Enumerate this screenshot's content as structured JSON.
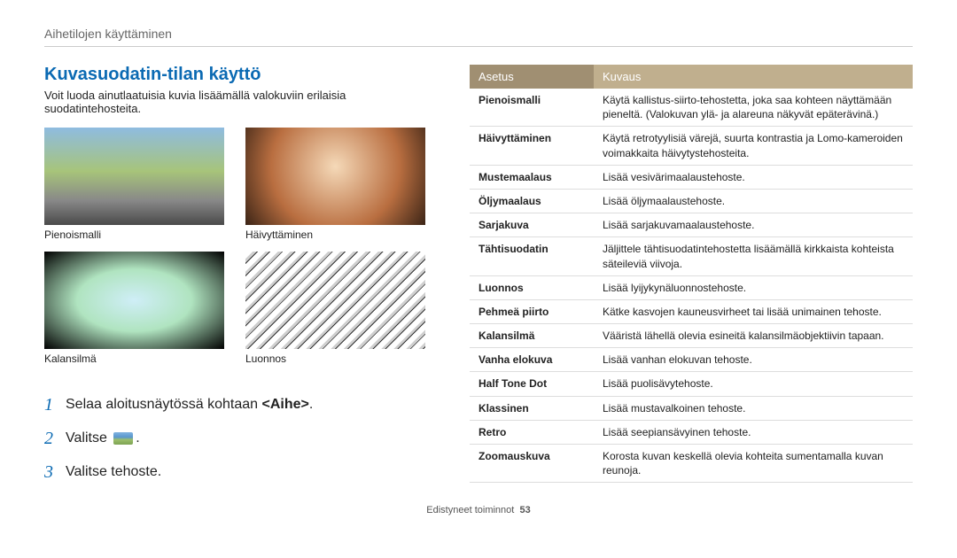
{
  "header": {
    "section": "Aihetilojen käyttäminen"
  },
  "left": {
    "title": "Kuvasuodatin-tilan käyttö",
    "intro": "Voit luoda ainutlaatuisia kuvia lisäämällä valokuviin erilaisia suodatintehosteita.",
    "thumbs": [
      {
        "label": "Pienoismalli"
      },
      {
        "label": "Häivyttäminen"
      },
      {
        "label": "Kalansilmä"
      },
      {
        "label": "Luonnos"
      }
    ],
    "steps": {
      "s1a": "Selaa aloitusnäytössä kohtaan ",
      "s1b": "<Aihe>",
      "s1c": ".",
      "s2a": "Valitse ",
      "s2c": ".",
      "s3": "Valitse tehoste."
    }
  },
  "table": {
    "h1": "Asetus",
    "h2": "Kuvaus",
    "rows": [
      {
        "name": "Pienoismalli",
        "desc": "Käytä kallistus-siirto-tehostetta, joka saa kohteen näyttämään pieneltä. (Valokuvan ylä- ja alareuna näkyvät epäterävinä.)"
      },
      {
        "name": "Häivyttäminen",
        "desc": "Käytä retrotyylisiä värejä, suurta kontrastia ja Lomo-kameroiden voimakkaita häivytystehosteita."
      },
      {
        "name": "Mustemaalaus",
        "desc": "Lisää vesivärimaalaustehoste."
      },
      {
        "name": "Öljymaalaus",
        "desc": "Lisää öljymaalaustehoste."
      },
      {
        "name": "Sarjakuva",
        "desc": "Lisää sarjakuvamaalaustehoste."
      },
      {
        "name": "Tähtisuodatin",
        "desc": "Jäljittele tähtisuodatintehostetta lisäämällä kirkkaista kohteista säteileviä viivoja."
      },
      {
        "name": "Luonnos",
        "desc": "Lisää lyijykynäluonnostehoste."
      },
      {
        "name": "Pehmeä piirto",
        "desc": "Kätke kasvojen kauneusvirheet tai lisää unimainen tehoste."
      },
      {
        "name": "Kalansilmä",
        "desc": "Vääristä lähellä olevia esineitä kalansilmäobjektiivin tapaan."
      },
      {
        "name": "Vanha elokuva",
        "desc": "Lisää vanhan elokuvan tehoste."
      },
      {
        "name": "Half Tone Dot",
        "desc": "Lisää puolisävytehoste."
      },
      {
        "name": "Klassinen",
        "desc": "Lisää mustavalkoinen tehoste."
      },
      {
        "name": "Retro",
        "desc": "Lisää seepiansävyinen tehoste."
      },
      {
        "name": "Zoomauskuva",
        "desc": "Korosta kuvan keskellä olevia kohteita sumentamalla kuvan reunoja."
      }
    ]
  },
  "footer": {
    "book": "Edistyneet toiminnot",
    "page": "53"
  }
}
